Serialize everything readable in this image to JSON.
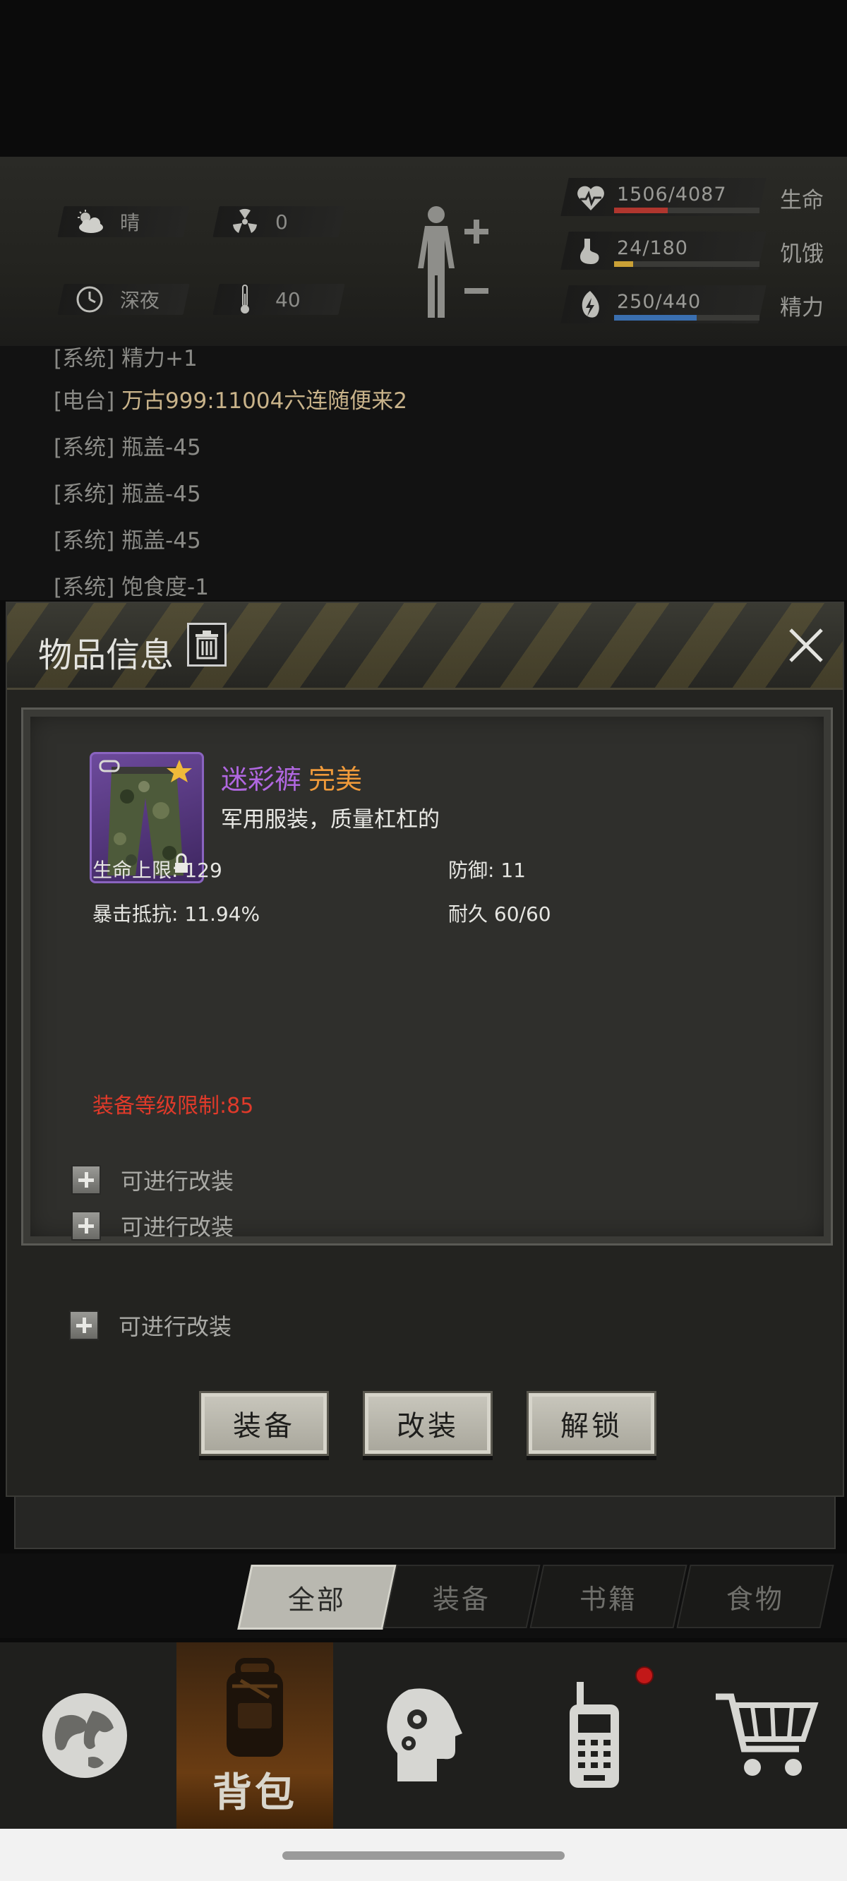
{
  "status": {
    "weather": {
      "icon": "cloud-sun-icon",
      "label": "晴"
    },
    "radiation": {
      "icon": "radiation-icon",
      "value": "0"
    },
    "time": {
      "icon": "clock-icon",
      "label": "深夜"
    },
    "temperature": {
      "icon": "thermometer-icon",
      "value": "40"
    },
    "bars": [
      {
        "icon": "heart-pulse-icon",
        "value": "1506/4087",
        "label": "生命",
        "fraction": 0.368,
        "color": "#b0362e"
      },
      {
        "icon": "stomach-icon",
        "value": "24/180",
        "label": "饥饿",
        "fraction": 0.133,
        "color": "#c9a036"
      },
      {
        "icon": "energy-icon",
        "value": "250/440",
        "label": "精力",
        "fraction": 0.568,
        "color": "#3a6fb0"
      }
    ]
  },
  "log": [
    {
      "tag": "[系统]",
      "text": "精力+1"
    },
    {
      "tag": "[电台]",
      "text": "万古999:11004六连随便来2",
      "color": "#c9b38a"
    },
    {
      "tag": "[系统]",
      "text": "瓶盖-45"
    },
    {
      "tag": "[系统]",
      "text": "瓶盖-45"
    },
    {
      "tag": "[系统]",
      "text": "瓶盖-45"
    },
    {
      "tag": "[系统]",
      "text": "饱食度-1"
    }
  ],
  "dialog": {
    "title": "物品信息",
    "item": {
      "name": "迷彩裤",
      "quality": "完美",
      "description": "军用服装，质量杠杠的"
    },
    "stats": {
      "hp_max": "生命上限: 129",
      "defense": "防御: 11",
      "crit_resist": "暴击抵抗: 11.94%",
      "durability": "耐久 60/60"
    },
    "level_limit": "装备等级限制:85",
    "mods": [
      "可进行改装",
      "可进行改装",
      "可进行改装"
    ],
    "buttons": {
      "equip": "装备",
      "modify": "改装",
      "unlock": "解锁"
    }
  },
  "tabs": [
    "全部",
    "装备",
    "书籍",
    "食物"
  ],
  "nav": {
    "bag_label": "背包",
    "items": [
      "globe-icon",
      "backpack-icon",
      "brain-gear-icon",
      "radio-icon",
      "cart-icon"
    ]
  }
}
